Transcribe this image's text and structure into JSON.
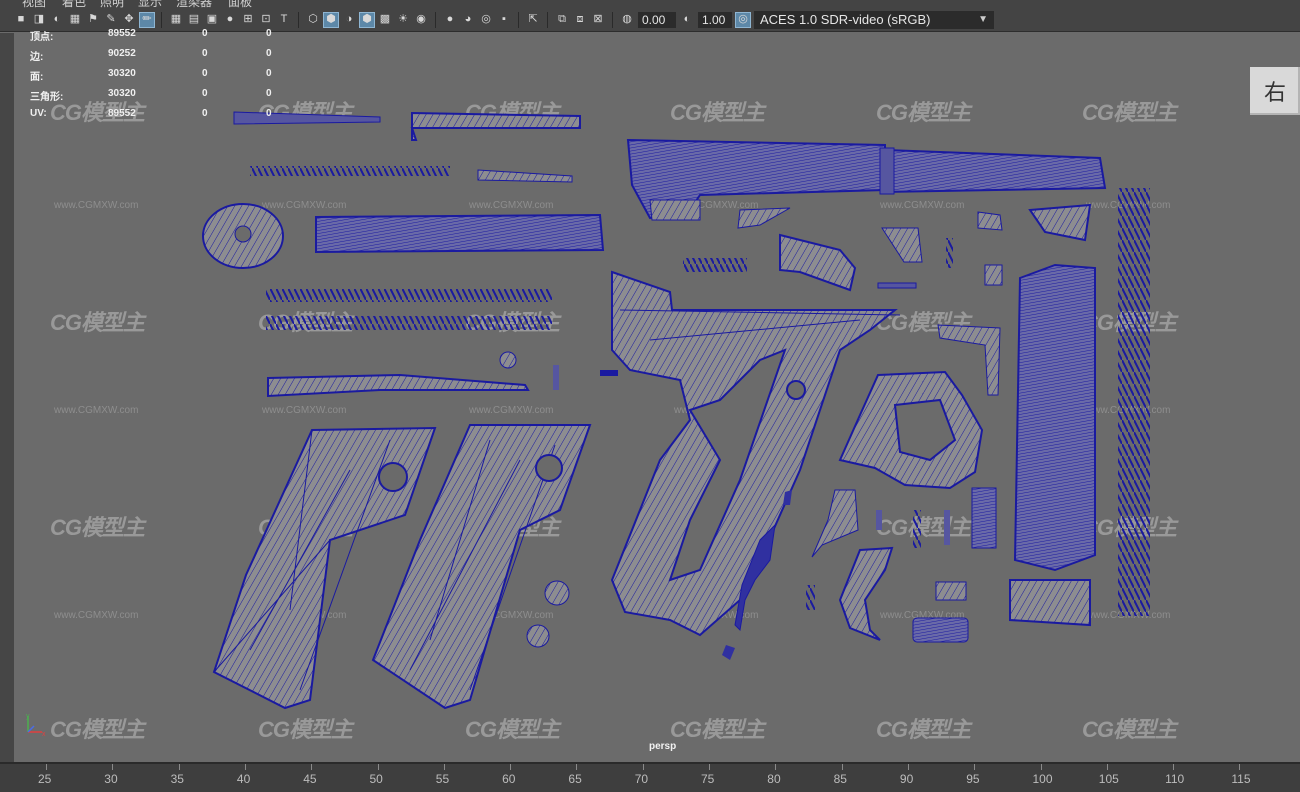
{
  "menu": {
    "items": [
      "视图",
      "着色",
      "照明",
      "显示",
      "渲染器",
      "面板"
    ]
  },
  "toolbar": {
    "exposure_value": "0.00",
    "gamma_value": "1.00",
    "color_space": "ACES 1.0 SDR-video (sRGB)",
    "icons": [
      "camera-icon",
      "camera-attributes-icon",
      "bookmark-icon",
      "image-plane-icon",
      "grid-icon",
      "film-gate-icon",
      "resolution-gate-icon",
      "gate-mask-icon",
      "field-chart-icon",
      "safe-action-icon",
      "safe-title-icon",
      "wireframe-icon",
      "smooth-shade-icon",
      "use-default-material-icon",
      "wireframe-on-shaded-icon",
      "xray-icon",
      "lighting-icon",
      "shadows-icon",
      "ambient-occlusion-icon",
      "motion-blur-icon",
      "anti-alias-icon",
      "depth-of-field-icon",
      "isolate-select-icon",
      "xray-joints-icon",
      "xray-active-icon",
      "exposure-icon",
      "gamma-icon",
      "color-management-icon"
    ]
  },
  "hud": {
    "rows": [
      {
        "label": "顶点:",
        "value": "89552",
        "sel": "0",
        "comp": "0"
      },
      {
        "label": "边:",
        "value": "90252",
        "sel": "0",
        "comp": "0"
      },
      {
        "label": "面:",
        "value": "30320",
        "sel": "0",
        "comp": "0"
      },
      {
        "label": "三角形:",
        "value": "30320",
        "sel": "0",
        "comp": "0"
      },
      {
        "label": "UV:",
        "value": "89552",
        "sel": "0",
        "comp": "0"
      }
    ]
  },
  "viewport": {
    "camera": "persp",
    "viewcube_label": "右",
    "watermark_text": "CG模型主",
    "watermark_url": "www.CGMXW.com",
    "wire_color": "#1a1aa0",
    "fill_color": "#8a8a8c",
    "background_color": "#6b6b6b"
  },
  "timeline": {
    "ticks": [
      "25",
      "30",
      "35",
      "40",
      "45",
      "50",
      "55",
      "60",
      "65",
      "70",
      "75",
      "80",
      "85",
      "90",
      "95",
      "100",
      "105",
      "110",
      "115"
    ]
  }
}
